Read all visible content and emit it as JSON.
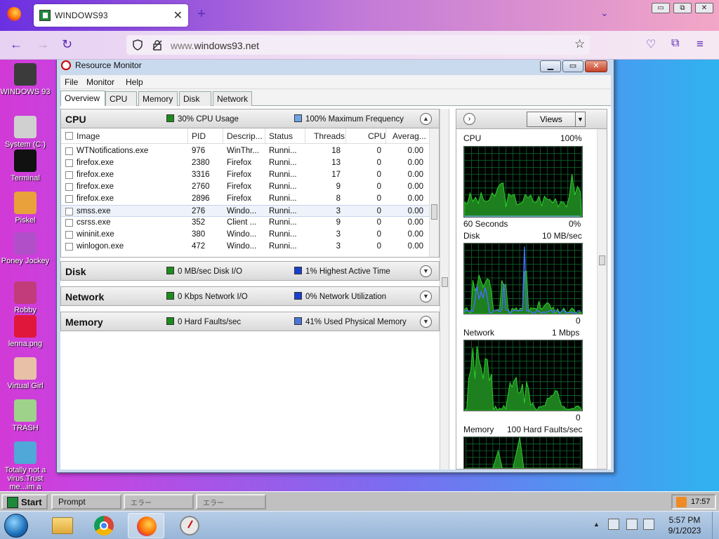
{
  "browser": {
    "tab_title": "WINDOWS93",
    "tab_close": "✕",
    "newtab": "+",
    "tab_list": "⌄",
    "url_prefix": "www.",
    "url_host": "windows93.net",
    "win_min": "▭",
    "win_max": "⧉",
    "win_close": "✕"
  },
  "desktop_icons": [
    {
      "label": "WINDOWS 93",
      "icon": "computer-icon",
      "color": "#3b3b3b"
    },
    {
      "label": "System (C:)",
      "icon": "drive-icon",
      "color": "#d0d0d0"
    },
    {
      "label": "Terminal",
      "icon": "terminal-icon",
      "color": "#111111"
    },
    {
      "label": "Piskel",
      "icon": "palette-icon",
      "color": "#e9a13b"
    },
    {
      "label": "Poney Jockey",
      "icon": "pony-icon",
      "color": "#b04fc8"
    },
    {
      "label": "Robby",
      "icon": "robot-icon",
      "color": "#c23b7a"
    },
    {
      "label": "lenna.png",
      "icon": "image-icon",
      "color": "#e0173b"
    },
    {
      "label": "Virtual Girl",
      "icon": "face-icon",
      "color": "#e8c0a8"
    },
    {
      "label": "TRASH",
      "icon": "trash-icon",
      "color": "#9ed28a"
    },
    {
      "label": "Totally not a virus.Trust me...im a",
      "icon": "dolphin-icon",
      "color": "#4fa8d8"
    }
  ],
  "resmon": {
    "title": "Resource Monitor",
    "menu": [
      "File",
      "Monitor",
      "Help"
    ],
    "tabs": [
      "Overview",
      "CPU",
      "Memory",
      "Disk",
      "Network"
    ],
    "cpu": {
      "title": "CPU",
      "usage": "30% CPU Usage",
      "freq": "100% Maximum Frequency",
      "columns": [
        "Image",
        "PID",
        "Descrip...",
        "Status",
        "Threads",
        "CPU",
        "Averag..."
      ],
      "rows": [
        {
          "image": "WTNotifications.exe",
          "pid": "976",
          "desc": "WinThr...",
          "status": "Runni...",
          "threads": "18",
          "cpu": "0",
          "avg": "0.00"
        },
        {
          "image": "firefox.exe",
          "pid": "2380",
          "desc": "Firefox",
          "status": "Runni...",
          "threads": "13",
          "cpu": "0",
          "avg": "0.00"
        },
        {
          "image": "firefox.exe",
          "pid": "3316",
          "desc": "Firefox",
          "status": "Runni...",
          "threads": "17",
          "cpu": "0",
          "avg": "0.00"
        },
        {
          "image": "firefox.exe",
          "pid": "2760",
          "desc": "Firefox",
          "status": "Runni...",
          "threads": "9",
          "cpu": "0",
          "avg": "0.00"
        },
        {
          "image": "firefox.exe",
          "pid": "2896",
          "desc": "Firefox",
          "status": "Runni...",
          "threads": "8",
          "cpu": "0",
          "avg": "0.00"
        },
        {
          "image": "smss.exe",
          "pid": "276",
          "desc": "Windo...",
          "status": "Runni...",
          "threads": "3",
          "cpu": "0",
          "avg": "0.00"
        },
        {
          "image": "csrss.exe",
          "pid": "352",
          "desc": "Client ...",
          "status": "Runni...",
          "threads": "9",
          "cpu": "0",
          "avg": "0.00"
        },
        {
          "image": "wininit.exe",
          "pid": "380",
          "desc": "Windo...",
          "status": "Runni...",
          "threads": "3",
          "cpu": "0",
          "avg": "0.00"
        },
        {
          "image": "winlogon.exe",
          "pid": "472",
          "desc": "Windo...",
          "status": "Runni...",
          "threads": "3",
          "cpu": "0",
          "avg": "0.00"
        }
      ]
    },
    "disk": {
      "title": "Disk",
      "io": "0 MB/sec Disk I/O",
      "active": "1% Highest Active Time"
    },
    "network": {
      "title": "Network",
      "io": "0 Kbps Network I/O",
      "util": "0% Network Utilization"
    },
    "memory": {
      "title": "Memory",
      "faults": "0 Hard Faults/sec",
      "used": "41% Used Physical Memory"
    },
    "views_label": "Views",
    "graphs": {
      "cpu_label": "CPU",
      "cpu_max": "100%",
      "cpu_time": "60 Seconds",
      "cpu_min": "0%",
      "disk_label": "Disk",
      "disk_max": "10 MB/sec",
      "disk_min": "0",
      "net_label": "Network",
      "net_max": "1 Mbps",
      "net_min": "0",
      "mem_label": "Memory",
      "mem_max": "100 Hard Faults/sec"
    },
    "colors": {
      "green": "#1c8c1c",
      "blue": "#1a3fd0",
      "light_blue": "#6fa3e8"
    }
  },
  "taskbar93": {
    "start": "Start",
    "items": [
      "Prompt",
      "エラー",
      "エラー"
    ],
    "clock": "17:57"
  },
  "taskbar7": {
    "time": "5:57 PM",
    "date": "9/1/2023",
    "tray_arrow": "▲"
  }
}
